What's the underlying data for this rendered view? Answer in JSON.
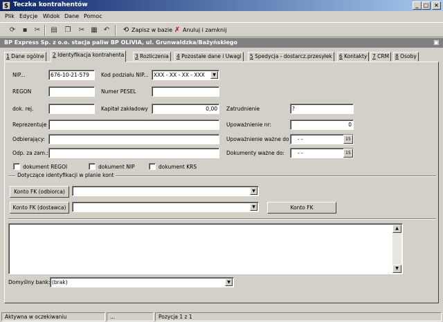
{
  "window": {
    "title": "Teczka kontrahentów",
    "app_icon": "$",
    "controls": {
      "minimize": "_",
      "maximize": "□",
      "close": "×"
    }
  },
  "menu": [
    "Plik",
    "Edycje",
    "Widok",
    "Dane",
    "Pomoc"
  ],
  "toolbar": {
    "save_label": "Zapisz w bazie",
    "cancel_close_label": "Anuluj i zamknij"
  },
  "context": {
    "text": "BP Express Sp. z o.o.  stacja paliw BP OLIVIA, ul. Grunwaldzka/Bażyńskiego"
  },
  "tabs": [
    {
      "num": "1",
      "label": "Dane ogólne"
    },
    {
      "num": "2",
      "label": "Identyfikacja kontrahenta"
    },
    {
      "num": "3",
      "label": "Rozliczenia"
    },
    {
      "num": "4",
      "label": "Pozostałe dane i Uwagi"
    },
    {
      "num": "5",
      "label": "Spedycja - dostarcz.przesyłek"
    },
    {
      "num": "6",
      "label": "Kontakty"
    },
    {
      "num": "7",
      "label": "CRM"
    },
    {
      "num": "8",
      "label": "Osoby"
    }
  ],
  "active_tab": "2",
  "form": {
    "nip_label": "NIP...",
    "nip_value": "676-10-21-579",
    "kod_label": "Kod podziału NIP...",
    "kod_value": "XXX - XX - XX - XXX",
    "regon_label": "REGON",
    "regon_value": "",
    "pesel_label": "Numer PESEL",
    "pesel_value": "",
    "dokrej_label": "dok. rej.",
    "dokrej_value": "",
    "kapital_label": "Kapitał zakładowy",
    "kapital_value": "0,00",
    "zatrudnienie_label": "Zatrudnienie",
    "zatrudnienie_value": "?",
    "reprezentuje_label": "Reprezentuje",
    "reprezentuje_value": "",
    "upowaznienie_nr_label": "Upoważnienie nr:",
    "upowaznienie_nr_value": "0",
    "odbierajacy_label": "Odbierający:",
    "odbierajacy_value": "",
    "upowaznienie_wazne_label": "Upoważnienie ważne do",
    "upowaznienie_wazne_value": "- -",
    "odp_label": "Odp. za zam.:",
    "odp_value": "",
    "dokumenty_wazne_label": "Dokumenty ważne do:",
    "dokumenty_wazne_value": "- -",
    "cal_icon": "15",
    "checkboxes": [
      {
        "label": "dokument REGOI",
        "checked": false
      },
      {
        "label": "dokument NIP",
        "checked": false
      },
      {
        "label": "dokument KRS",
        "checked": false
      }
    ],
    "group_title": "Dotyczące identyfikacji w planie kont",
    "konto_odbiorca_label": "Konto FK (odbiorca)",
    "konto_odbiorca_value": "",
    "konto_dostawca_label": "Konto FK (dostawca)",
    "konto_dostawca_value": "",
    "konto_fk_label": "Konto FK",
    "bank_label": "Domyślny bank:",
    "bank_value": "(brak)"
  },
  "status": {
    "state": "Aktywna w oczekiwaniu",
    "mid": "...",
    "position": "Pozycja 1 z 1"
  }
}
